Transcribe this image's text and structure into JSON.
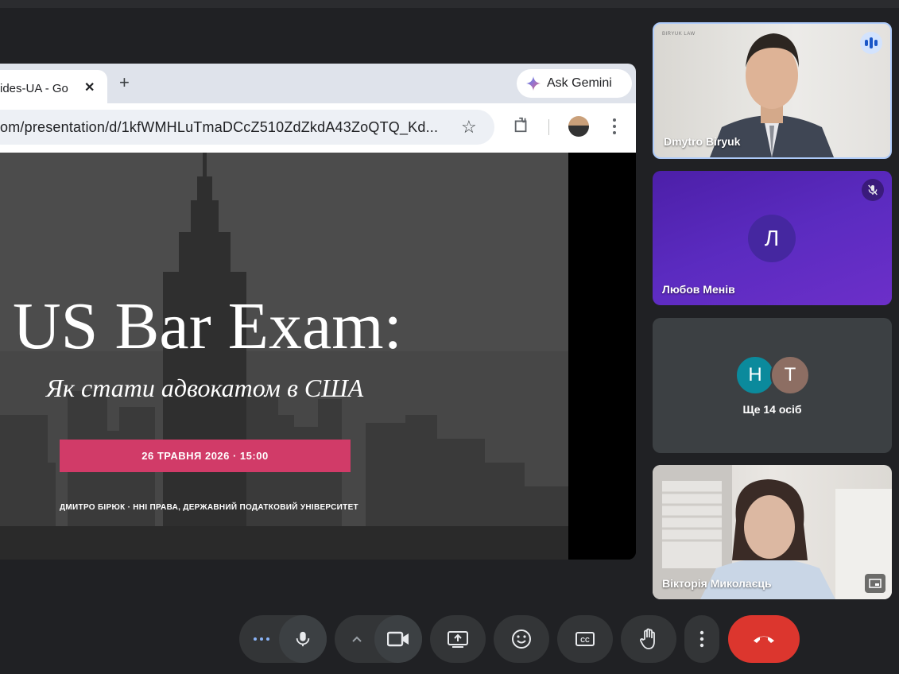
{
  "browser": {
    "tab_title": "ides-UA - Go",
    "new_tab_icon": "+",
    "gemini_label": "Ask Gemini",
    "url": "om/presentation/d/1kfWMHLuTmaDCcZ510ZdZkdA43ZoQTQ_Kd..."
  },
  "slide": {
    "title": "US Bar Exam:",
    "subtitle": "Як стати адвокатом в США",
    "date": "26 ТРАВНЯ 2026 · 15:00",
    "author": "ДМИТРО БІРЮК · ННІ ПРАВА, ДЕРЖАВНИЙ ПОДАТКОВИЙ УНІВЕРСИТЕТ"
  },
  "participants": [
    {
      "name": "Dmytro Biryuk",
      "watermark": "BIRYUK LAW",
      "state": "speaking"
    },
    {
      "name": "Любов Менів",
      "initial": "Л",
      "state": "muted",
      "color": "#4527a0"
    },
    {
      "avatars": [
        {
          "initial": "Н",
          "color": "#0b8a9c"
        },
        {
          "initial": "Т",
          "color": "#8d6e63"
        }
      ],
      "more": "Ще 14 осіб"
    },
    {
      "name": "Вікторія Миколаєць"
    }
  ],
  "controls": {
    "hangup_color": "#dc362e"
  }
}
